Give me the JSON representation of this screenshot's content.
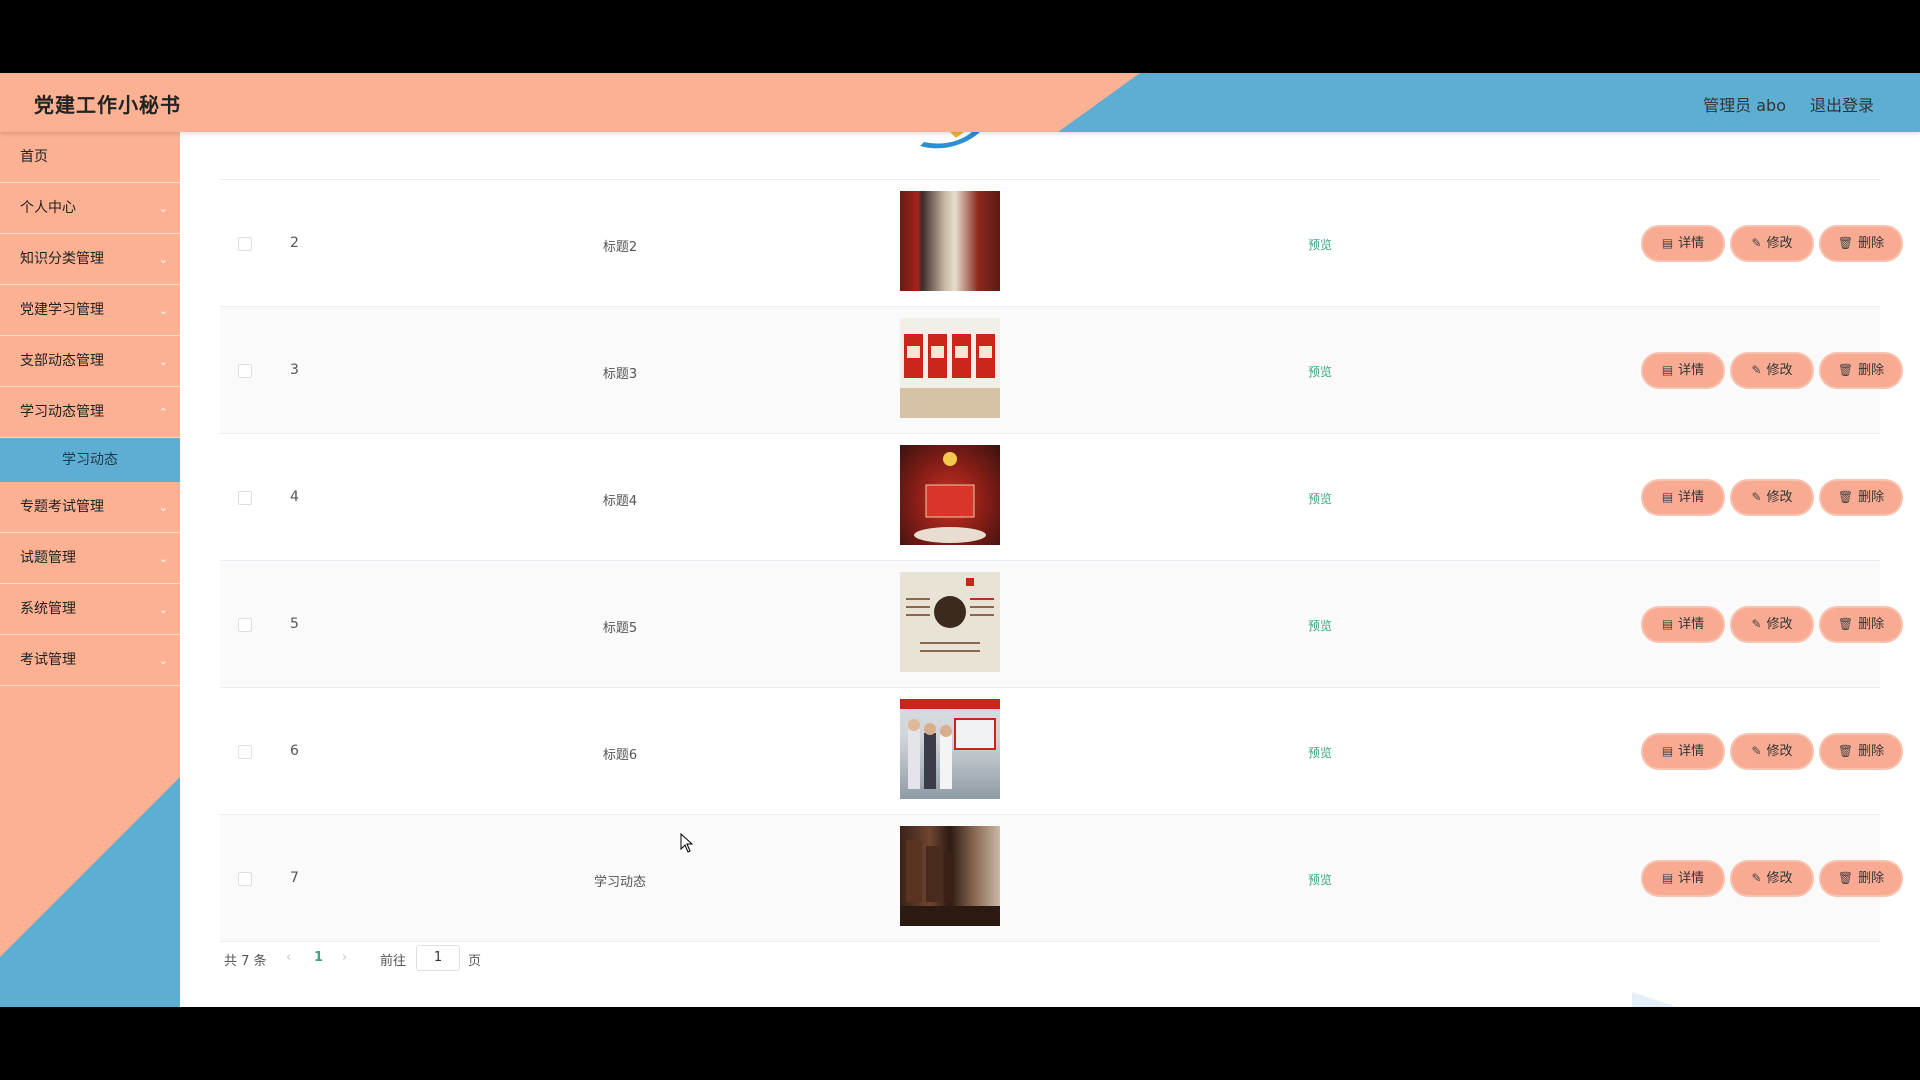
{
  "header": {
    "title": "党建工作小秘书",
    "user": "管理员 abo",
    "logout": "退出登录"
  },
  "sidebar": {
    "items": [
      {
        "label": "首页"
      },
      {
        "label": "个人中心"
      },
      {
        "label": "知识分类管理"
      },
      {
        "label": "党建学习管理"
      },
      {
        "label": "支部动态管理"
      },
      {
        "label": "学习动态管理"
      },
      {
        "label": "专题考试管理"
      },
      {
        "label": "试题管理"
      },
      {
        "label": "系统管理"
      },
      {
        "label": "考试管理"
      }
    ],
    "submenu_active": "学习动态"
  },
  "table": {
    "preview_label": "预览",
    "detail_label": "详情",
    "edit_label": "修改",
    "delete_label": "删除",
    "rows": [
      {
        "index": "2",
        "title": "标题2"
      },
      {
        "index": "3",
        "title": "标题3"
      },
      {
        "index": "4",
        "title": "标题4"
      },
      {
        "index": "5",
        "title": "标题5"
      },
      {
        "index": "6",
        "title": "标题6"
      },
      {
        "index": "7",
        "title": "学习动态"
      }
    ]
  },
  "pagination": {
    "total": "共 7 条",
    "current_page": "1",
    "goto_prefix": "前往",
    "goto_value": "1",
    "goto_suffix": "页"
  },
  "colors": {
    "salmon": "#fbb192",
    "blue": "#5eaed3",
    "preview_green": "#3aa67f"
  }
}
